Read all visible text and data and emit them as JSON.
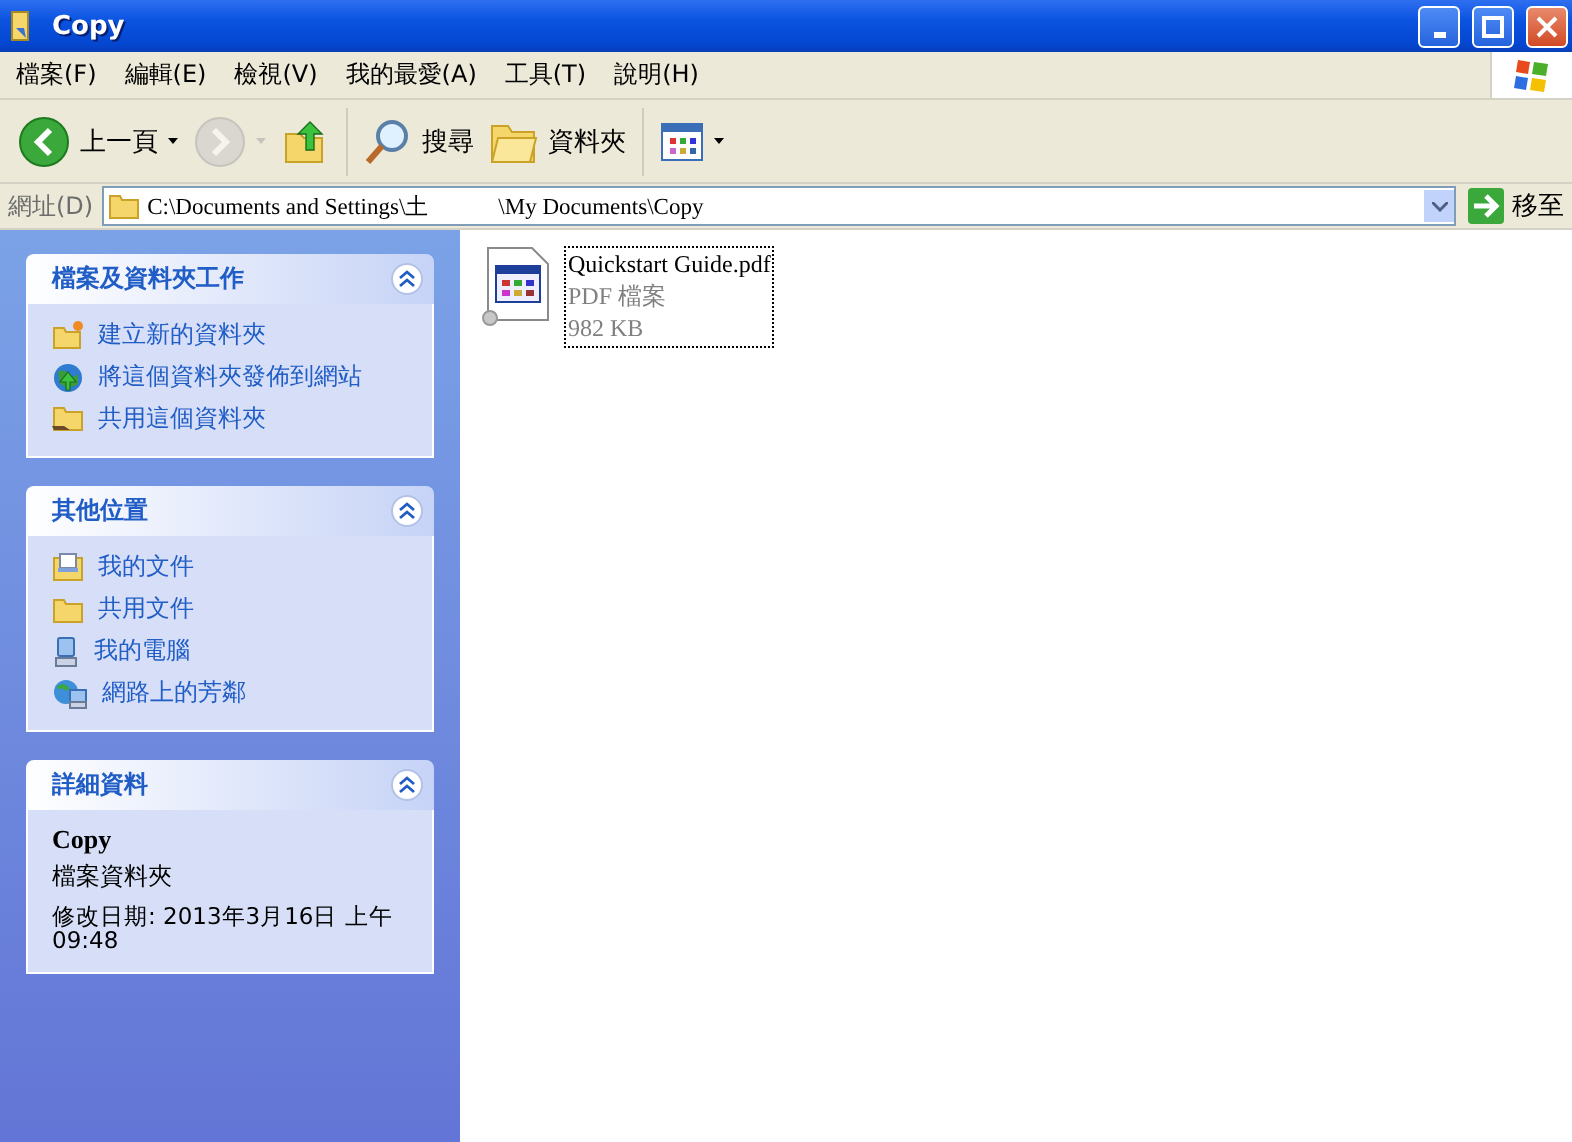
{
  "window": {
    "title": "Copy"
  },
  "menu": [
    {
      "label": "檔案(F)"
    },
    {
      "label": "編輯(E)"
    },
    {
      "label": "檢視(V)"
    },
    {
      "label": "我的最愛(A)"
    },
    {
      "label": "工具(T)"
    },
    {
      "label": "說明(H)"
    }
  ],
  "toolbar": {
    "buttons": [
      {
        "kind": "back",
        "label": "上一頁",
        "disabled": false
      },
      {
        "kind": "forward",
        "disabled": true
      },
      {
        "kind": "up",
        "disabled": false
      },
      {
        "kind": "search",
        "label": "搜尋",
        "disabled": false
      },
      {
        "kind": "folders",
        "label": "資料夾",
        "disabled": false
      },
      {
        "kind": "views",
        "disabled": false
      }
    ]
  },
  "address": {
    "label": "網址(D)",
    "value": "C:\\Documents and Settings\\土            \\My Documents\\Copy",
    "go_label": "移至"
  },
  "sidebar": {
    "panels": [
      {
        "kind": "links",
        "title": "檔案及資料夾工作",
        "expanded": true,
        "items": [
          {
            "kind": "new-folder",
            "label": "建立新的資料夾"
          },
          {
            "kind": "publish",
            "label": "將這個資料夾發佈到網站"
          },
          {
            "kind": "share",
            "label": "共用這個資料夾"
          }
        ]
      },
      {
        "kind": "links",
        "title": "其他位置",
        "expanded": true,
        "items": [
          {
            "kind": "documents",
            "label": "我的文件"
          },
          {
            "kind": "folder",
            "label": "共用文件"
          },
          {
            "kind": "computer",
            "label": "我的電腦"
          },
          {
            "kind": "network",
            "label": "網路上的芳鄰"
          }
        ]
      },
      {
        "kind": "details",
        "title": "詳細資料",
        "expanded": true,
        "name": "Copy",
        "type": "檔案資料夾",
        "modified": "修改日期: 2013年3月16日 上午 09:48"
      }
    ]
  },
  "files": [
    {
      "name": "Quickstart Guide.pdf",
      "type": "PDF 檔案",
      "size": "982 KB",
      "focused": true
    }
  ]
}
